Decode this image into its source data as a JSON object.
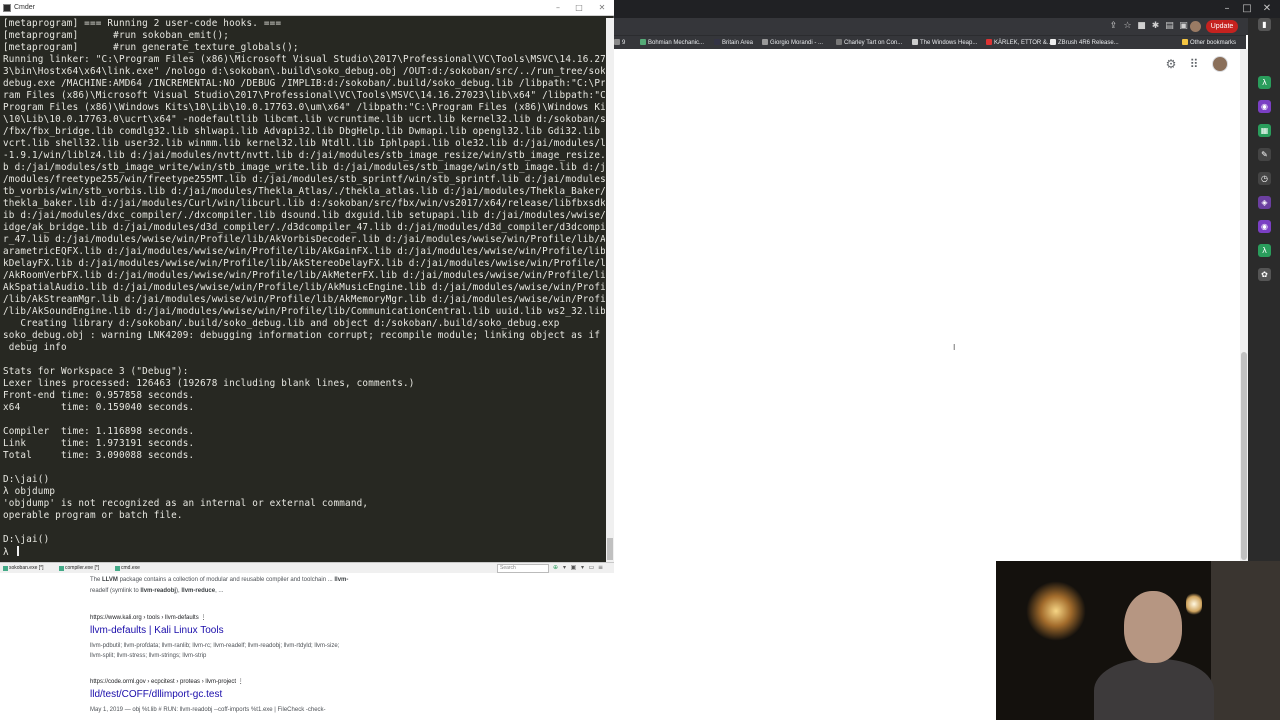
{
  "terminal": {
    "title": "Cmder",
    "lines": [
      "[metaprogram] === Running 2 user-code hooks. ===",
      "[metaprogram]      #run sokoban_emit();",
      "[metaprogram]      #run generate_texture_globals();",
      "Running linker: \"C:\\Program Files (x86)\\Microsoft Visual Studio\\2017\\Professional\\VC\\Tools\\MSVC\\14.16.2702",
      "3\\bin\\Hostx64\\x64\\link.exe\" /nologo d:\\sokoban\\.build\\soko_debug.obj /OUT:d:/sokoban/src/../run_tree/soko_",
      "debug.exe /MACHINE:AMD64 /INCREMENTAL:NO /DEBUG /IMPLIB:d:/sokoban/.build/soko_debug.lib /libpath:\"C:\\Prog",
      "ram Files (x86)\\Microsoft Visual Studio\\2017\\Professional\\VC\\Tools\\MSVC\\14.16.27023\\lib\\x64\" /libpath:\"C:\\",
      "Program Files (x86)\\Windows Kits\\10\\Lib\\10.0.17763.0\\um\\x64\" /libpath:\"C:\\Program Files (x86)\\Windows Kits",
      "\\10\\Lib\\10.0.17763.0\\ucrt\\x64\" -nodefaultlib libcmt.lib vcruntime.lib ucrt.lib kernel32.lib d:/sokoban/src",
      "/fbx/fbx_bridge.lib comdlg32.lib shlwapi.lib Advapi32.lib DbgHelp.lib Dwmapi.lib opengl32.lib Gdi32.lib ms",
      "vcrt.lib shell32.lib user32.lib winmm.lib kernel32.lib Ntdll.lib Iphlpapi.lib ole32.lib d:/jai/modules/lz4",
      "-1.9.1/win/liblz4.lib d:/jai/modules/nvtt/nvtt.lib d:/jai/modules/stb_image_resize/win/stb_image_resize.li",
      "b d:/jai/modules/stb_image_write/win/stb_image_write.lib d:/jai/modules/stb_image/win/stb_image.lib d:/jai",
      "/modules/freetype255/win/freetype255MT.lib d:/jai/modules/stb_sprintf/win/stb_sprintf.lib d:/jai/modules/s",
      "tb_vorbis/win/stb_vorbis.lib d:/jai/modules/Thekla_Atlas/./thekla_atlas.lib d:/jai/modules/Thekla_Baker/./",
      "thekla_baker.lib d:/jai/modules/Curl/win/libcurl.lib d:/sokoban/src/fbx/win/vs2017/x64/release/libfbxsdk.l",
      "ib d:/jai/modules/dxc_compiler/./dxcompiler.lib dsound.lib dxguid.lib setupapi.lib d:/jai/modules/wwise/br",
      "idge/ak_bridge.lib d:/jai/modules/d3d_compiler/./d3dcompiler_47.lib d:/jai/modules/d3d_compiler/d3dcompile",
      "r_47.lib d:/jai/modules/wwise/win/Profile/lib/AkVorbisDecoder.lib d:/jai/modules/wwise/win/Profile/lib/AkP",
      "arametricEQFX.lib d:/jai/modules/wwise/win/Profile/lib/AkGainFX.lib d:/jai/modules/wwise/win/Profile/lib/A",
      "kDelayFX.lib d:/jai/modules/wwise/win/Profile/lib/AkStereoDelayFX.lib d:/jai/modules/wwise/win/Profile/lib",
      "/AkRoomVerbFX.lib d:/jai/modules/wwise/win/Profile/lib/AkMeterFX.lib d:/jai/modules/wwise/win/Profile/lib/",
      "AkSpatialAudio.lib d:/jai/modules/wwise/win/Profile/lib/AkMusicEngine.lib d:/jai/modules/wwise/win/Profile",
      "/lib/AkStreamMgr.lib d:/jai/modules/wwise/win/Profile/lib/AkMemoryMgr.lib d:/jai/modules/wwise/win/Profile",
      "/lib/AkSoundEngine.lib d:/jai/modules/wwise/win/Profile/lib/CommunicationCentral.lib uuid.lib ws2_32.lib",
      "   Creating library d:/sokoban/.build/soko_debug.lib and object d:/sokoban/.build/soko_debug.exp",
      "soko_debug.obj : warning LNK4209: debugging information corrupt; recompile module; linking object as if no",
      " debug info",
      "",
      "Stats for Workspace 3 (\"Debug\"):",
      "Lexer lines processed: 126463 (192678 including blank lines, comments.)",
      "Front-end time: 0.957858 seconds.",
      "x64       time: 0.159040 seconds.",
      "",
      "Compiler  time: 1.116898 seconds.",
      "Link      time: 1.973191 seconds.",
      "Total     time: 3.090088 seconds.",
      "",
      "D:\\jai()",
      "λ objdump",
      "'objdump' is not recognized as an internal or external command,",
      "operable program or batch file.",
      "",
      "D:\\jai()",
      "λ "
    ],
    "tabs": [
      "sokoban.exe [*]",
      "compiler.exe [*]",
      "cmd.exe"
    ],
    "search_placeholder": "Search"
  },
  "browser": {
    "update_label": "Update",
    "other_bookmarks": "Other bookmarks",
    "bookmarks": [
      "Bohmian Mechanic...",
      "Britain Area",
      "Giorgio Morandi - ...",
      "Charley Tart on Con...",
      "The Windows Heap...",
      "KÄRLEK, ETTOR &...",
      "ZBrush 4R6 Release..."
    ]
  },
  "results": {
    "r1_snippet_a": "The ",
    "r1_snippet_b": "LLVM",
    "r1_snippet_c": " package contains a collection of modular and reusable compiler and toolchain ... ",
    "r1_snippet_d": "llvm-",
    "r1_line2_a": "readelf (symlink to ",
    "r1_line2_b": "llvm-readobj",
    "r1_line2_c": "), ",
    "r1_line2_d": "llvm-reduce",
    "r1_line2_e": ", ...",
    "r2_cite": "https://www.kali.org › tools › llvm-defaults   ⋮",
    "r2_title": "llvm-defaults | Kali Linux Tools",
    "r2_line1": "llvm-pdbutil; llvm-profdata; llvm-ranlib; llvm-rc; llvm-readelf; llvm-readobj; llvm-rtdyld; llvm-size;",
    "r2_line2": "llvm-split; llvm-stress; llvm-strings; llvm-strip",
    "r3_cite": "https://code.orml.gov › ecpcitest › proteas › llvm-project   ⋮",
    "r3_title": "lld/test/COFF/dllimport-gc.test",
    "r3_line1": "May 1, 2019 — obj %t.lib # RUN: llvm-readobj --coff-imports %t1.exe | FileCheck -check-"
  }
}
